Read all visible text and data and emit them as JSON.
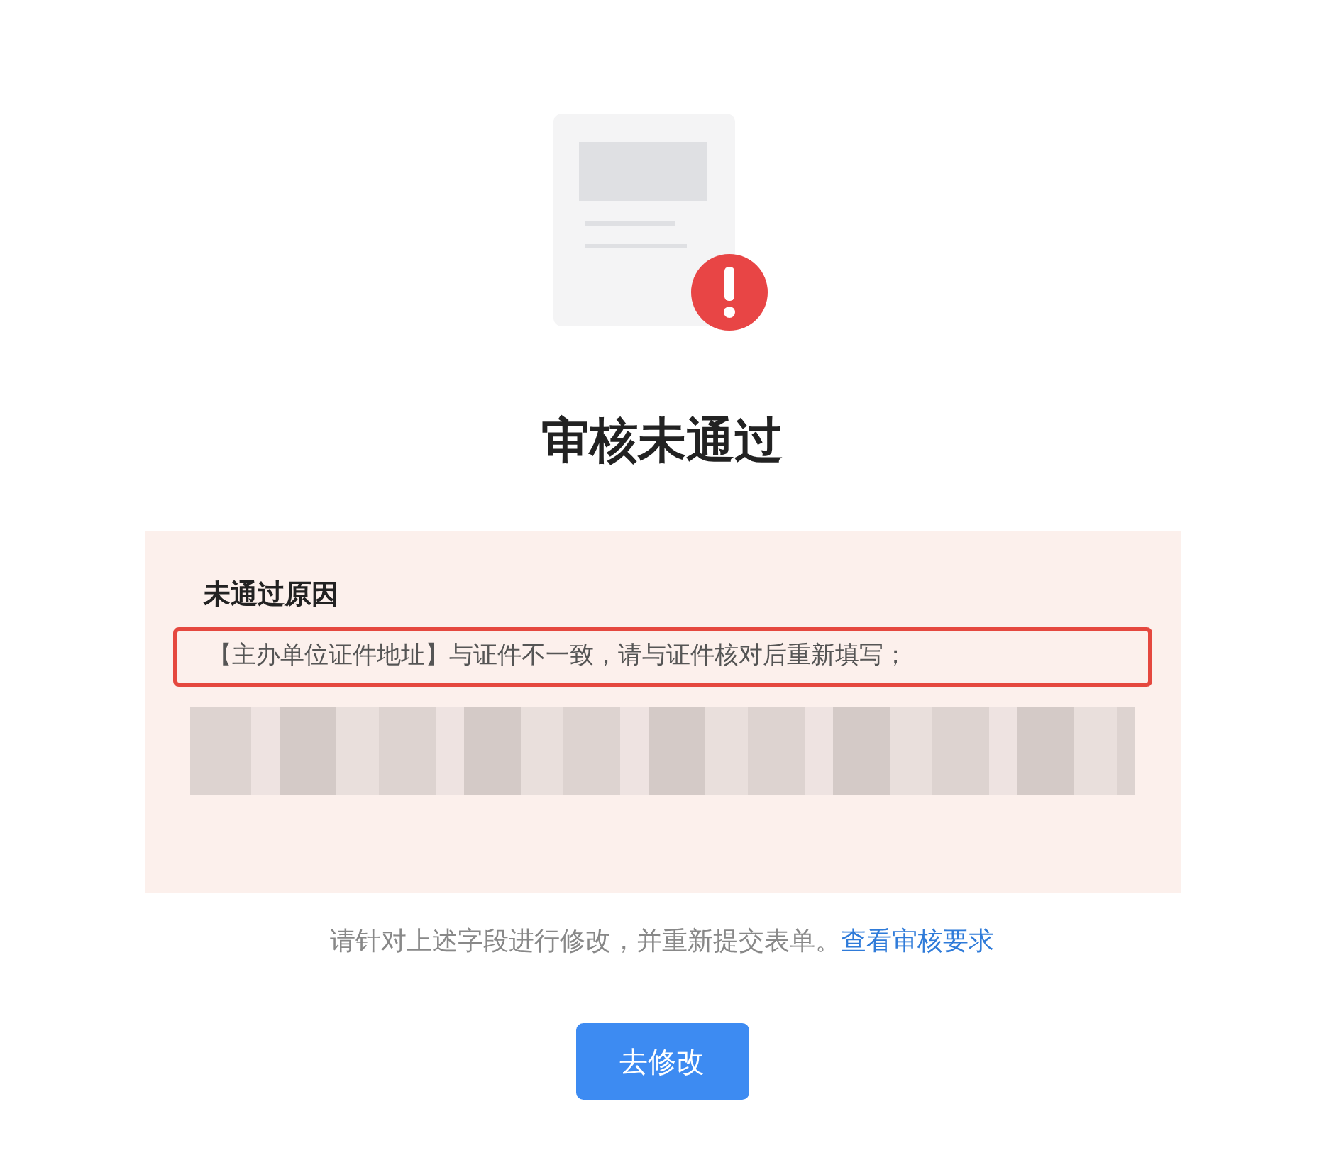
{
  "title": "审核未通过",
  "reason_card": {
    "heading": "未通过原因",
    "reasons": [
      {
        "kind": "text",
        "text": "【主办单位证件地址】与证件不一致，请与证件核对后重新填写；",
        "highlighted": true
      },
      {
        "kind": "redacted",
        "highlighted": false
      }
    ]
  },
  "hint": {
    "text": "请针对上述字段进行修改，并重新提交表单。",
    "link": "查看审核要求"
  },
  "button": "去修改"
}
